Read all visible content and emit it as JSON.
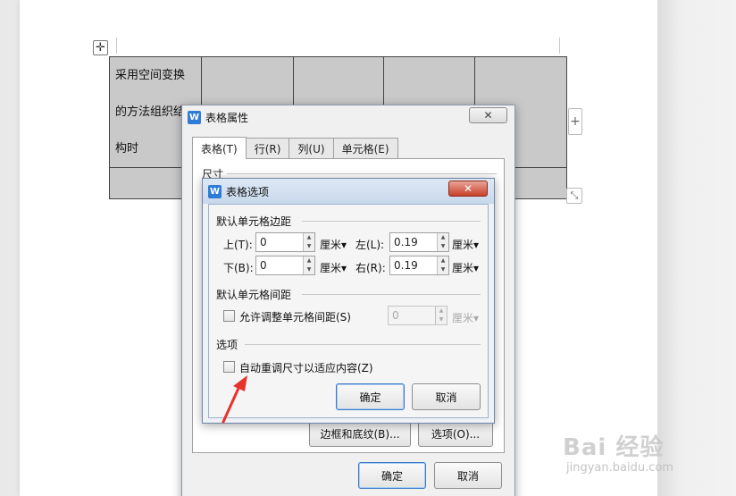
{
  "document": {
    "cell_lines": [
      "采用空间变换",
      "的方法组织结",
      "构时"
    ]
  },
  "table_properties": {
    "title": "表格属性",
    "tabs": [
      {
        "label": "表格(T)"
      },
      {
        "label": "行(R)"
      },
      {
        "label": "列(U)"
      },
      {
        "label": "单元格(E)"
      }
    ],
    "size_label": "尺寸",
    "borders_button": "边框和底纹(B)...",
    "options_button": "选项(O)...",
    "ok": "确定",
    "cancel": "取消"
  },
  "table_options": {
    "title": "表格选项",
    "margins_group": "默认单元格边距",
    "top_label": "上(T):",
    "top_value": "0",
    "bottom_label": "下(B):",
    "bottom_value": "0",
    "left_label": "左(L):",
    "left_value": "0.19",
    "right_label": "右(R):",
    "right_value": "0.19",
    "unit": "厘米▾",
    "spacing_group": "默认单元格间距",
    "allow_spacing_label": "允许调整单元格间距(S)",
    "spacing_value": "0",
    "options_group": "选项",
    "auto_resize_label": "自动重调尺寸以适应内容(Z)",
    "ok": "确定",
    "cancel": "取消"
  },
  "watermark": {
    "logo": "Bai 经验",
    "url": "jingyan.baidu.com"
  },
  "colors": {
    "accent": "#3b78c4",
    "close_red": "#c8402a",
    "table_fill": "#c9c9c9",
    "arrow": "#e8322c"
  }
}
